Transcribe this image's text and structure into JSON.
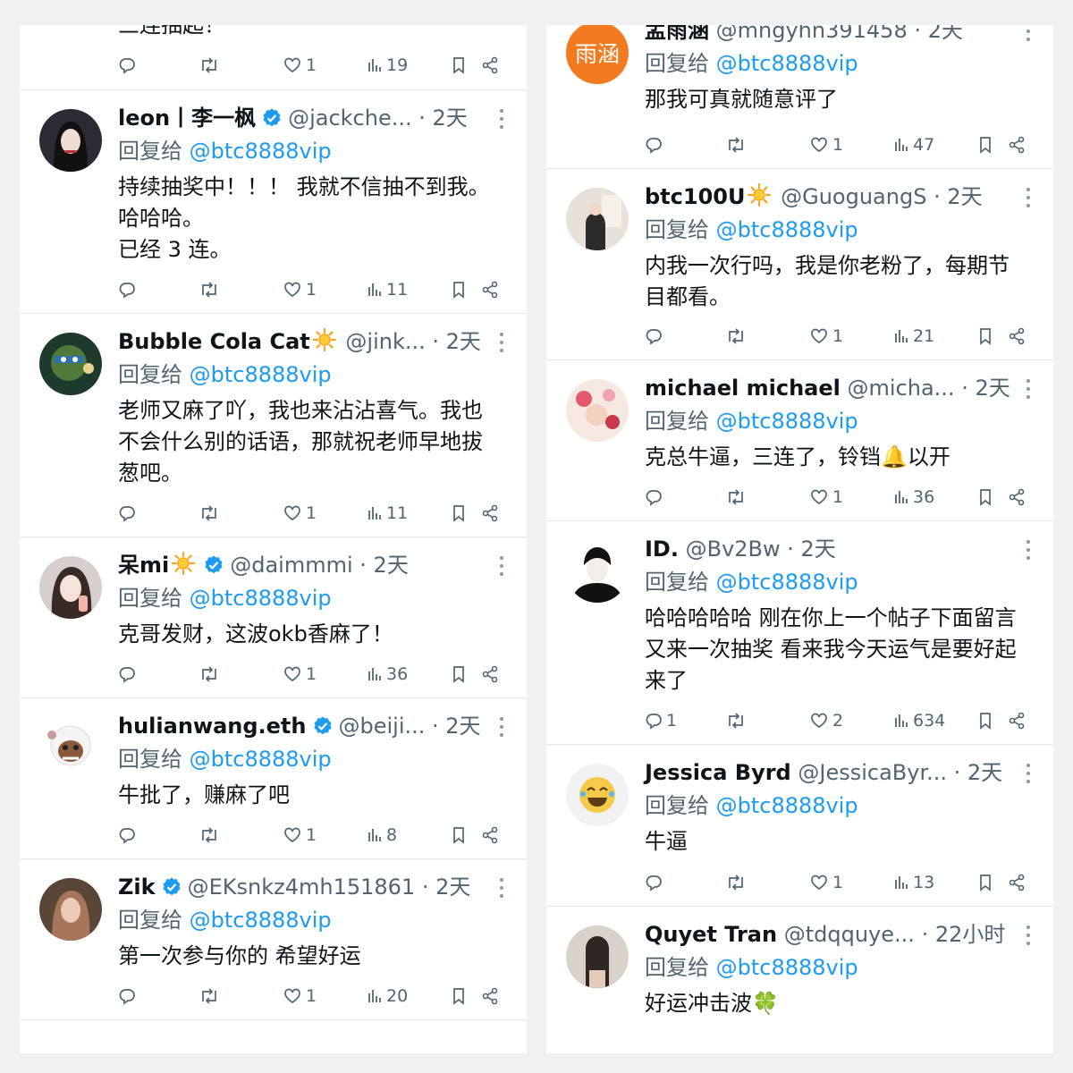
{
  "reply_prefix": "回复给",
  "reply_to": "@btc8888vip",
  "left_column": {
    "partial_top": {
      "text": "三连抽起！",
      "views": "19",
      "likes": "1"
    },
    "tweets": [
      {
        "name": "leon丨李一枫",
        "verified": true,
        "sun": false,
        "handle": "@jackche...",
        "time": "· 2天",
        "lines": [
          "持续抽奖中！！！ 我就不信抽不到我。",
          "哈哈哈。",
          "已经 3 连。"
        ],
        "replies": "",
        "likes": "1",
        "views": "11"
      },
      {
        "name": "Bubble Cola Cat",
        "verified": false,
        "sun": true,
        "handle": "@jink...",
        "time": "· 2天",
        "lines": [
          "老师又麻了吖，我也来沾沾喜气。我也",
          "不会什么别的话语，那就祝老师早地拔",
          "葱吧。"
        ],
        "replies": "",
        "likes": "1",
        "views": "11"
      },
      {
        "name": "呆mi",
        "verified": true,
        "sun": true,
        "handle": "@daimmmi",
        "time": "· 2天",
        "lines": [
          "克哥发财，这波okb香麻了！"
        ],
        "replies": "",
        "likes": "1",
        "views": "36"
      },
      {
        "name": "hulianwang.eth",
        "verified": true,
        "sun": false,
        "handle": "@beiji...",
        "time": "· 2天",
        "lines": [
          "牛批了，赚麻了吧"
        ],
        "replies": "",
        "likes": "1",
        "views": "8"
      },
      {
        "name": "Zik",
        "verified": true,
        "sun": false,
        "handle": "@EKsnkz4mh151861",
        "time": "· 2天",
        "lines": [
          "第一次参与你的 希望好运"
        ],
        "replies": "",
        "likes": "1",
        "views": "20"
      }
    ]
  },
  "right_column": {
    "tweets": [
      {
        "name": "孟雨涵",
        "verified": false,
        "sun": false,
        "handle": "@mngyhn391458",
        "time": "· 2天",
        "avatar_text": "雨涵",
        "lines": [
          "那我可真就随意评了"
        ],
        "replies": "",
        "likes": "1",
        "views": "47"
      },
      {
        "name": "btc100U",
        "verified": false,
        "sun": true,
        "handle": "@GuoguangS",
        "time": "· 2天",
        "lines": [
          "内我一次行吗，我是你老粉了，每期节",
          "目都看。"
        ],
        "replies": "",
        "likes": "1",
        "views": "21"
      },
      {
        "name": "michael michael",
        "verified": false,
        "sun": false,
        "handle": "@micha...",
        "time": "· 2天",
        "lines": [
          "克总牛逼，三连了，铃铛🔔以开"
        ],
        "replies": "",
        "likes": "1",
        "views": "36"
      },
      {
        "name": "ID.",
        "verified": false,
        "sun": false,
        "handle": "@Bv2Bw",
        "time": "· 2天",
        "lines": [
          "哈哈哈哈哈 刚在你上一个帖子下面留言",
          "又来一次抽奖 看来我今天运气是要好起",
          "来了"
        ],
        "replies": "1",
        "likes": "2",
        "views": "634"
      },
      {
        "name": "Jessica Byrd",
        "verified": false,
        "sun": false,
        "handle": "@JessicaByr...",
        "time": "· 2天",
        "lines": [
          "牛逼"
        ],
        "replies": "",
        "likes": "1",
        "views": "13"
      },
      {
        "name": "Quyet Tran",
        "verified": false,
        "sun": false,
        "handle": "@tdqquye...",
        "time": "· 22小时",
        "lines": [
          "好运冲击波🍀"
        ],
        "replies": "",
        "likes": "",
        "views": ""
      }
    ]
  },
  "icons": [
    "reply-icon",
    "retweet-icon",
    "like-icon",
    "views-icon",
    "bookmark-icon",
    "share-icon",
    "more-icon",
    "verified-badge-icon",
    "sun-emoji-icon"
  ],
  "colors": {
    "link": "#1d9bf0",
    "verified": "#1d9bf0",
    "muted": "#536471",
    "avatar_orange": "#f47a1f"
  }
}
